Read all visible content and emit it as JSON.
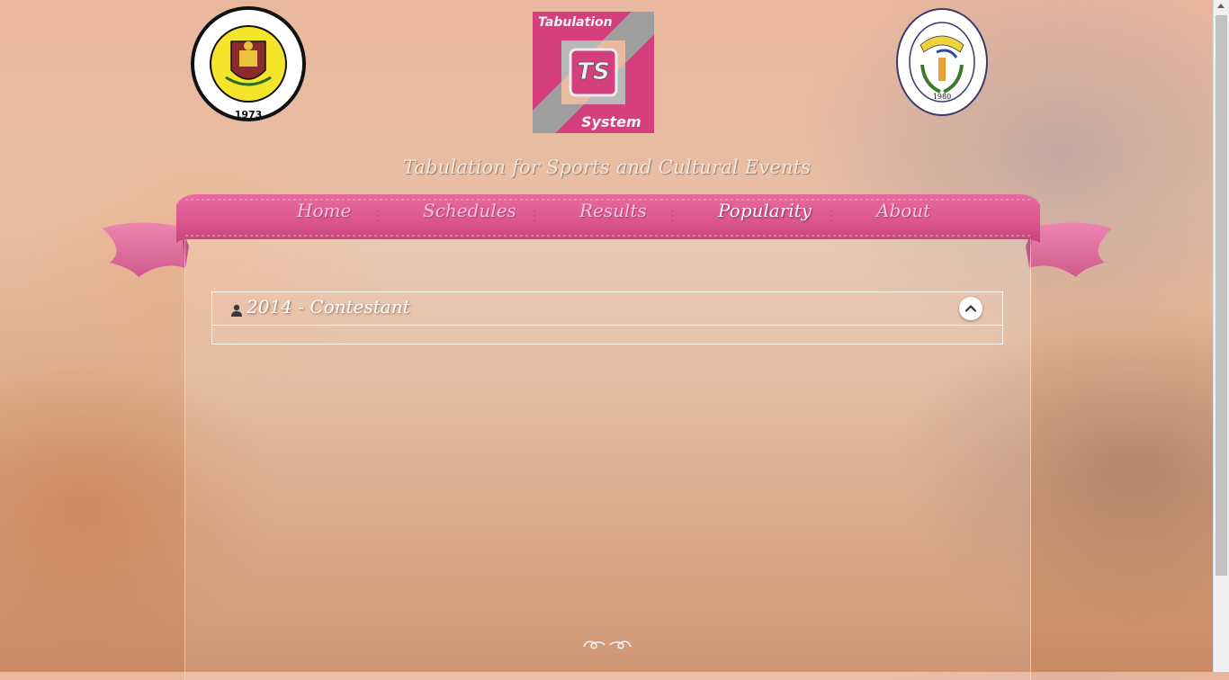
{
  "header": {
    "logo_left": {
      "name": "msu-naawan-seal-logo",
      "ring_text": "MINDANAO STATE UNIVERSITY AT NAAWAN",
      "year": "1973",
      "place": "NAAWAN, MIS. OR."
    },
    "logo_center": {
      "name": "tabulation-system-logo",
      "top_text": "Tabulation",
      "initials": "TS",
      "bottom_text": "System"
    },
    "logo_right": {
      "name": "supreme-student-government-logo",
      "ring_top": "SUPREME STUDENT GOVERNMENT",
      "ring_bottom": "MINDANAO STATE UNIVERSITY AT NAAWAN",
      "year": "1980"
    },
    "tagline": "Tabulation for Sports and Cultural Events"
  },
  "nav": {
    "items": [
      {
        "label": "Home",
        "active": false
      },
      {
        "label": "Schedules",
        "active": false
      },
      {
        "label": "Results",
        "active": false
      },
      {
        "label": "Popularity",
        "active": true
      },
      {
        "label": "About",
        "active": false
      }
    ]
  },
  "accordion": {
    "title": "2014 - Contestant",
    "icon": "user-icon",
    "toggle_icon": "chevron-up-icon",
    "expanded": true
  },
  "footer": {
    "ornament_icon": "flourish-icon"
  },
  "colors": {
    "ribbon_pink": "#e0558f",
    "ribbon_dark": "#b93c70",
    "nav_text": "#f4c9dc",
    "nav_active": "#ffffff",
    "logo_pink": "#d63f7e",
    "seal_yellow": "#f4e42a"
  }
}
